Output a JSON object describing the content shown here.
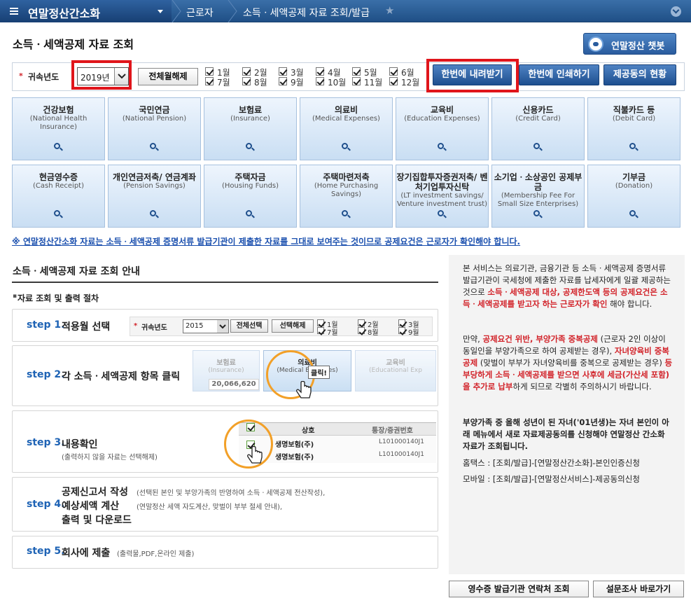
{
  "nav": {
    "app_title": "연말정산간소화",
    "breadcrumb_1": "근로자",
    "breadcrumb_2": "소득ㆍ세액공제 자료 조회/발급"
  },
  "page_title": "소득ㆍ세액공제 자료 조회",
  "chatbot_label": "연말정산 챗봇",
  "yearbar": {
    "year_label": "귀속년도",
    "year_value": "2019년",
    "toggle_all": "전체월해제",
    "months": [
      "1월",
      "2월",
      "3월",
      "4월",
      "5월",
      "6월",
      "7월",
      "8월",
      "9월",
      "10월",
      "11월",
      "12월"
    ],
    "download_all": "한번에 내려받기",
    "print_all": "한번에 인쇄하기",
    "consent_status": "제공동의 현황"
  },
  "categories": [
    {
      "ko": "건강보험",
      "en": "(National Health Insurance)"
    },
    {
      "ko": "국민연금",
      "en": "(National Pension)"
    },
    {
      "ko": "보험료",
      "en": "(Insurance)"
    },
    {
      "ko": "의료비",
      "en": "(Medical Expenses)"
    },
    {
      "ko": "교육비",
      "en": "(Education Expenses)"
    },
    {
      "ko": "신용카드",
      "en": "(Credit Card)"
    },
    {
      "ko": "직불카드 등",
      "en": "(Debit Card)"
    },
    {
      "ko": "현금영수증",
      "en": "(Cash Receipt)"
    },
    {
      "ko": "개인연금저축/ 연금계좌",
      "en": "(Pension Savings)"
    },
    {
      "ko": "주택자금",
      "en": "(Housing Funds)"
    },
    {
      "ko": "주택마련저축",
      "en": "(Home Purchasing Savings)"
    },
    {
      "ko": "장기집합투자증권저축/ 벤처기업투자신탁",
      "en": "(LT investment savings/ Venture investment trust)"
    },
    {
      "ko": "소기업ㆍ소상공인 공제부금",
      "en": "(Membership Fee For Small Size Enterprises)"
    },
    {
      "ko": "기부금",
      "en": "(Donation)"
    }
  ],
  "notice": "※ 연말정산간소화 자료는 소득ㆍ세액공제 증명서류 발급기관이 제출한 자료를 그대로 보여주는 것이므로 공제요건은 근로자가 확인해야 합니다.",
  "guide": {
    "title": "소득ㆍ세액공제 자료 조회 안내",
    "proc_title": "자료 조회 및 출력 절차",
    "step1": {
      "label": "step 1.",
      "text": "적용월 선택",
      "year_label": "귀속년도",
      "year": "2015",
      "sel_all": "전체선택",
      "desel_all": "선택해제",
      "months": [
        "1월",
        "2월",
        "3월",
        "7월",
        "8월",
        "9월"
      ]
    },
    "step2": {
      "label": "step 2.",
      "text": "각 소득ㆍ세액공제 항목 클릭",
      "ins_ko": "보험료",
      "ins_en": "(Insurance)",
      "amount": "20,066,620",
      "med_ko": "의료비",
      "med_en": "(Medical Expenses)",
      "click": "클릭!",
      "edu_ko": "교육비",
      "edu_en": "(Educational Exp"
    },
    "step3": {
      "label": "step 3.",
      "text": "내용확인",
      "sub": "(출력하지 않을 자료는 선택해제)",
      "col1": "상호",
      "col2": "통장/증권번호",
      "row1_name": "생명보험(주)",
      "row1_no": "L101000140J1",
      "row2_name": "생명보험(주)",
      "row2_no": "L101000140J1"
    },
    "step4": {
      "label": "step 4.",
      "line1": "공제신고서 작성",
      "line2": "예상세액 계산",
      "line3": "출력 및 다운로드",
      "sub1": "(선택된 본인 및 부양가족의 반영하여 소득ㆍ세액공제 전산작성),",
      "sub2": "(연말정산 세액 자도계산, 맞벌이 부부 절세 안내),"
    },
    "step5": {
      "label": "step 5.",
      "text": "회사에 제출",
      "sub": "(출력물,PDF,온라인 제출)"
    }
  },
  "info": {
    "p1_a": "본 서비스는 의료기관, 금융기관 등 소득ㆍ세액공제 증명서류 발급기관이 국세청에 제출한 자료를 납세자에게 일괄 제공하는 것으로 ",
    "p1_red": "소득ㆍ세액공제 대상, 공제한도액 등의 공제요건은 소득ㆍ세액공제를 받고자 하는 근로자가 확인",
    "p1_b": " 해야 합니다.",
    "p2_a": "만약, ",
    "p2_r1": "공제요건 위반, 부양가족 중복공제",
    "p2_b": " (근로자 2인 이상이 동일인을 부양가족으로 하여 공제받는 경우), ",
    "p2_r2": "자녀양육비 중복공제",
    "p2_c": " (맞벌이 부부가 자녀양육비를 중복으로 공제받는 경우) ",
    "p2_r3": "등 부당하게 소득ㆍ세액공제를 받으면 사후에 세금(가산세 포함)을 추가로 납부",
    "p2_d": "하게 되므로 각별히 주의하시기 바랍니다.",
    "p3": "부양가족 중 올해 성년이 된 자녀('01년생)는 자녀 본인이 아래 메뉴에서 새로 자료제공동의를 신청해야 연말정산 간소화 자료가 조회됩니다.",
    "p4": "홈택스 : [조회/발급]-[연말정산간소화]-본인인증신청",
    "p5": "모바일 : [조회/발급]-[연말정산서비스]-제공동의신청"
  },
  "footer": {
    "receipt_contact": "영수증 발급기관 연락처 조회",
    "survey": "설문조사 바로가기"
  }
}
